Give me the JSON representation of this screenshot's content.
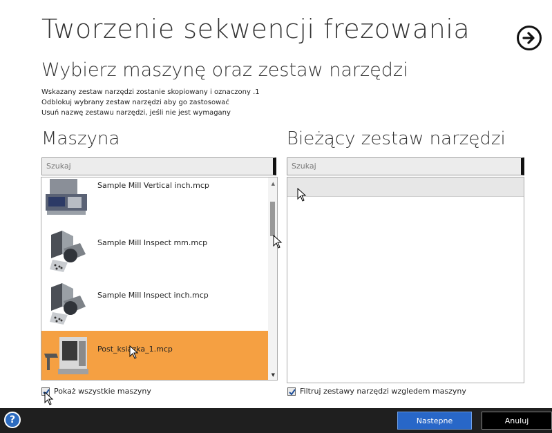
{
  "header": {
    "title": "Tworzenie sekwencji frezowania",
    "subtitle": "Wybierz maszynę oraz zestaw narzędzi",
    "info_lines": [
      "Wskazany zestaw narzędzi zostanie skopiowany i oznaczony .1",
      "Odblokuj wybrany zestaw narzędzi aby go zastosować",
      "Usuń nazwę zestawu narzędzi, jeśli nie jest wymagany"
    ],
    "next_icon": "arrow-right-circle-icon"
  },
  "machine_panel": {
    "heading": "Maszyna",
    "search_placeholder": "Szukaj",
    "items": [
      {
        "name": "Sample Mill Vertical inch.mcp",
        "selected": false
      },
      {
        "name": "Sample Mill Inspect mm.mcp",
        "selected": false
      },
      {
        "name": "Sample Mill Inspect inch.mcp",
        "selected": false
      },
      {
        "name": "Post_ksiazka_1.mcp",
        "selected": true
      }
    ],
    "show_all_label": "Pokaż wszystkie maszyny",
    "show_all_checked": true
  },
  "toolset_panel": {
    "heading": "Bieżący zestaw narzędzi",
    "search_placeholder": "Szukaj",
    "filter_label": "Filtruj zestawy narzędzi wzgledem maszyny",
    "filter_checked": true
  },
  "footer": {
    "help_label": "?",
    "next_label": "Nastepne",
    "cancel_label": "Anuluj"
  },
  "colors": {
    "selected_row": "#f5a042",
    "primary_button": "#2867c8",
    "footer_bg": "#1f1f1f"
  }
}
